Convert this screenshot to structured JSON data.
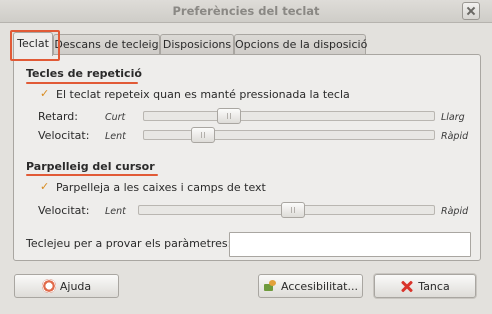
{
  "window": {
    "title": "Preferències del teclat"
  },
  "tabs": [
    {
      "label": "Teclat"
    },
    {
      "label": "Descans de tecleig"
    },
    {
      "label": "Disposicions"
    },
    {
      "label": "Opcions de la disposició"
    }
  ],
  "repeat": {
    "section_title": "Tecles de repetició",
    "checkbox_label": "El teclat repeteix quan es manté pressionada la tecla",
    "checked": true,
    "delay": {
      "label": "Retard:",
      "min_label": "Curt",
      "max_label": "Llarg",
      "value": 0.29
    },
    "speed": {
      "label": "Velocitat:",
      "min_label": "Lent",
      "max_label": "Ràpid",
      "value": 0.2
    }
  },
  "cursor": {
    "section_title": "Parpelleig del cursor",
    "checkbox_label": "Parpelleja a les caixes i camps de text",
    "checked": true,
    "speed": {
      "label": "Velocitat:",
      "min_label": "Lent",
      "max_label": "Ràpid",
      "value": 0.52
    }
  },
  "test": {
    "label": "Teclejeu per a provar els paràmetres:",
    "value": "",
    "placeholder": ""
  },
  "buttons": {
    "help": "Ajuda",
    "accessibility": "Accesibilitat...",
    "close": "Tanca"
  },
  "colors": {
    "accent": "#e15a36",
    "check": "#d88b1f"
  }
}
